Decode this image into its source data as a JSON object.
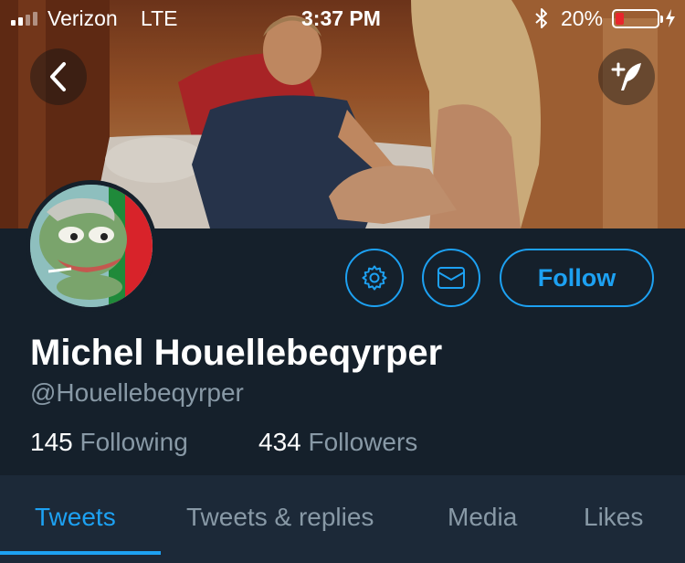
{
  "status_bar": {
    "carrier": "Verizon",
    "network": "LTE",
    "time": "3:37 PM",
    "battery_percent": "20%",
    "battery_level": 0.2,
    "icons": [
      "signal-icon",
      "bluetooth-icon",
      "battery-icon",
      "charging-icon"
    ]
  },
  "header": {
    "back_icon": "chevron-left-icon",
    "compose_icon": "compose-tweet-icon"
  },
  "profile": {
    "display_name": "Michel Houellebeqyrper",
    "handle": "@Houellebeqyrper",
    "following_count": "145",
    "following_label": "Following",
    "followers_count": "434",
    "followers_label": "Followers"
  },
  "actions": {
    "settings_icon": "gear-icon",
    "message_icon": "envelope-icon",
    "follow_label": "Follow"
  },
  "tabs": [
    {
      "label": "Tweets",
      "active": true
    },
    {
      "label": "Tweets & replies",
      "active": false
    },
    {
      "label": "Media",
      "active": false
    },
    {
      "label": "Likes",
      "active": false
    }
  ],
  "colors": {
    "background": "#15202b",
    "tab_bar": "#1c2938",
    "accent": "#1da1f2",
    "secondary_text": "#8899a6",
    "battery_low": "#e8262c"
  }
}
